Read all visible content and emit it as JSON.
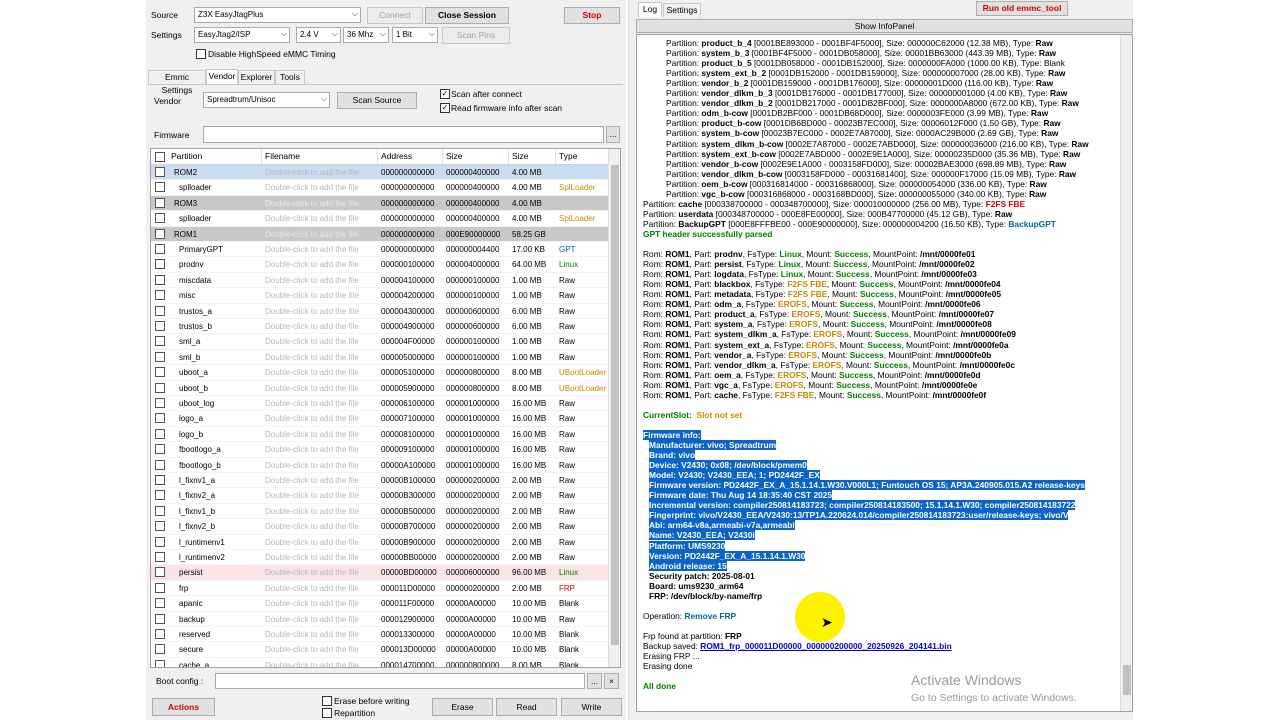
{
  "top": {
    "source_label": "Source",
    "source_value": "Z3X EasyJtagPlus",
    "connect_label": "Connect",
    "close_session_label": "Close Session",
    "stop_label": "Stop",
    "settings_label": "Settings",
    "settings_iface": "EasyJtag2/ISP",
    "settings_voltage": "2.4 V",
    "settings_freq": "36 Mhz",
    "settings_bits": "1 Bit",
    "scan_pins_label": "Scan Pins",
    "disable_hs_label": "Disable HighSpeed eMMC Timing"
  },
  "tabs": [
    "Emmc Settings",
    "Vendor",
    "Explorer",
    "Tools"
  ],
  "vendor": {
    "label": "Vendor",
    "value": "Spreadtrum/Unisoc",
    "scan_source_label": "Scan Source",
    "scan_after_connect": "Scan after connect",
    "read_fw_info": "Read firmware info after scan"
  },
  "firmware": {
    "label": "Firmware",
    "value": "",
    "browse": "..."
  },
  "grid": {
    "columns": [
      "Partition",
      "Filename",
      "Address",
      "Size",
      "Size",
      "Type"
    ],
    "rows": [
      {
        "p": "ROM2",
        "f": "Double-click to add the file",
        "a": "000000000000",
        "s": "000000400000",
        "h": "4.00 MB",
        "t": "",
        "kind": "sel"
      },
      {
        "p": "splloader",
        "f": "Double-click to add the file",
        "a": "000000000000",
        "s": "000000400000",
        "h": "4.00 MB",
        "t": "SplLoader",
        "kind": "sub"
      },
      {
        "p": "ROM3",
        "f": "Double-click to add the file",
        "a": "000000000000",
        "s": "000000400000",
        "h": "4.00 MB",
        "t": "",
        "kind": "grp"
      },
      {
        "p": "splloader",
        "f": "Double-click to add the file",
        "a": "000000000000",
        "s": "000000400000",
        "h": "4.00 MB",
        "t": "SplLoader",
        "kind": "sub"
      },
      {
        "p": "ROM1",
        "f": "Double-click to add the file",
        "a": "000000000000",
        "s": "000E90000000",
        "h": "58.25 GB",
        "t": "",
        "kind": "grp"
      },
      {
        "p": "PrimaryGPT",
        "f": "Double-click to add the file",
        "a": "000000000000",
        "s": "000000004400",
        "h": "17.00 KB",
        "t": "GPT",
        "kind": "sub"
      },
      {
        "p": "prodnv",
        "f": "Double-click to add the file",
        "a": "000000100000",
        "s": "000004000000",
        "h": "64.00 MB",
        "t": "Linux",
        "kind": "sub"
      },
      {
        "p": "miscdata",
        "f": "Double-click to add the file",
        "a": "000004100000",
        "s": "000000100000",
        "h": "1.00 MB",
        "t": "Raw",
        "kind": "sub"
      },
      {
        "p": "misc",
        "f": "Double-click to add the file",
        "a": "000004200000",
        "s": "000000100000",
        "h": "1.00 MB",
        "t": "Raw",
        "kind": "sub"
      },
      {
        "p": "trustos_a",
        "f": "Double-click to add the file",
        "a": "000004300000",
        "s": "000000600000",
        "h": "6.00 MB",
        "t": "Raw",
        "kind": "sub"
      },
      {
        "p": "trustos_b",
        "f": "Double-click to add the file",
        "a": "000004900000",
        "s": "000000600000",
        "h": "6.00 MB",
        "t": "Raw",
        "kind": "sub"
      },
      {
        "p": "sml_a",
        "f": "Double-click to add the file",
        "a": "000004F00000",
        "s": "000000100000",
        "h": "1.00 MB",
        "t": "Raw",
        "kind": "sub"
      },
      {
        "p": "sml_b",
        "f": "Double-click to add the file",
        "a": "000005000000",
        "s": "000000100000",
        "h": "1.00 MB",
        "t": "Raw",
        "kind": "sub"
      },
      {
        "p": "uboot_a",
        "f": "Double-click to add the file",
        "a": "000005100000",
        "s": "000000800000",
        "h": "8.00 MB",
        "t": "UBootLoader",
        "kind": "sub"
      },
      {
        "p": "uboot_b",
        "f": "Double-click to add the file",
        "a": "000005900000",
        "s": "000000800000",
        "h": "8.00 MB",
        "t": "UBootLoader",
        "kind": "sub"
      },
      {
        "p": "uboot_log",
        "f": "Double-click to add the file",
        "a": "000006100000",
        "s": "000001000000",
        "h": "16.00 MB",
        "t": "Raw",
        "kind": "sub"
      },
      {
        "p": "logo_a",
        "f": "Double-click to add the file",
        "a": "000007100000",
        "s": "000001000000",
        "h": "16.00 MB",
        "t": "Raw",
        "kind": "sub"
      },
      {
        "p": "logo_b",
        "f": "Double-click to add the file",
        "a": "000008100000",
        "s": "000001000000",
        "h": "16.00 MB",
        "t": "Raw",
        "kind": "sub"
      },
      {
        "p": "fbootlogo_a",
        "f": "Double-click to add the file",
        "a": "000009100000",
        "s": "000001000000",
        "h": "16.00 MB",
        "t": "Raw",
        "kind": "sub"
      },
      {
        "p": "fbootlogo_b",
        "f": "Double-click to add the file",
        "a": "00000A100000",
        "s": "000001000000",
        "h": "16.00 MB",
        "t": "Raw",
        "kind": "sub"
      },
      {
        "p": "l_fixnv1_a",
        "f": "Double-click to add the file",
        "a": "00000B100000",
        "s": "000000200000",
        "h": "2.00 MB",
        "t": "Raw",
        "kind": "sub"
      },
      {
        "p": "l_fixnv2_a",
        "f": "Double-click to add the file",
        "a": "00000B300000",
        "s": "000000200000",
        "h": "2.00 MB",
        "t": "Raw",
        "kind": "sub"
      },
      {
        "p": "l_fixnv1_b",
        "f": "Double-click to add the file",
        "a": "00000B500000",
        "s": "000000200000",
        "h": "2.00 MB",
        "t": "Raw",
        "kind": "sub"
      },
      {
        "p": "l_fixnv2_b",
        "f": "Double-click to add the file",
        "a": "00000B700000",
        "s": "000000200000",
        "h": "2.00 MB",
        "t": "Raw",
        "kind": "sub"
      },
      {
        "p": "l_runtimenv1",
        "f": "Double-click to add the file",
        "a": "00000B900000",
        "s": "000000200000",
        "h": "2.00 MB",
        "t": "Raw",
        "kind": "sub"
      },
      {
        "p": "l_runtimenv2",
        "f": "Double-click to add the file",
        "a": "00000BB00000",
        "s": "000000200000",
        "h": "2.00 MB",
        "t": "Raw",
        "kind": "sub"
      },
      {
        "p": "persist",
        "f": "Double-click to add the file",
        "a": "00000BD00000",
        "s": "000006000000",
        "h": "96.00 MB",
        "t": "Linux",
        "kind": "pink"
      },
      {
        "p": "frp",
        "f": "Double-click to add the file",
        "a": "000011D00000",
        "s": "000000200000",
        "h": "2.00 MB",
        "t": "FRP",
        "kind": "sub"
      },
      {
        "p": "apanic",
        "f": "Double-click to add the file",
        "a": "000011F00000",
        "s": "00000A00000",
        "h": "10.00 MB",
        "t": "Blank",
        "kind": "sub"
      },
      {
        "p": "backup",
        "f": "Double-click to add the file",
        "a": "000012900000",
        "s": "00000A00000",
        "h": "10.00 MB",
        "t": "Raw",
        "kind": "sub"
      },
      {
        "p": "reserved",
        "f": "Double-click to add the file",
        "a": "000013300000",
        "s": "00000A00000",
        "h": "10.00 MB",
        "t": "Blank",
        "kind": "sub"
      },
      {
        "p": "secure",
        "f": "Double-click to add the file",
        "a": "000013D00000",
        "s": "00000A00000",
        "h": "10.00 MB",
        "t": "Blank",
        "kind": "sub"
      },
      {
        "p": "cache_a",
        "f": "Double-click to add the file",
        "a": "000014700000",
        "s": "000000800000",
        "h": "8.00 MB",
        "t": "Blank",
        "kind": "sub"
      }
    ]
  },
  "bottom": {
    "boot_config_label": "Boot config :",
    "boot_config_value": "",
    "browse": "...",
    "clear": "×",
    "actions_label": "Actions",
    "erase_before_writing": "Erase before writing",
    "repartition": "Repartition",
    "erase_label": "Erase",
    "read_label": "Read",
    "write_label": "Write"
  },
  "right": {
    "tabs": [
      "Log",
      "Settings"
    ],
    "run_old_label": "Run old emmc_tool",
    "show_infopanel_label": "Show InfoPanel"
  },
  "type_colors": {
    "SplLoader": "#cc8800",
    "UBootLoader": "#cc8800",
    "GPT": "#006699",
    "Linux": "#008000",
    "FRP": "#e00000",
    "Raw": "#000000",
    "Blank": "#000000"
  },
  "log": {
    "partitions": [
      {
        "ind": "    ",
        "name": "product_b_4",
        "range": "[0001BE893000 - 0001BF4F5000]",
        "size": "000000C62000 (12.38 MB)",
        "type": "Raw"
      },
      {
        "ind": "    ",
        "name": "system_b_3",
        "range": "[0001BF4F5000 - 0001DB058000]",
        "size": "00001BB63000 (443.39 MB)",
        "type": "Raw"
      },
      {
        "ind": "    ",
        "name": "product_b_5",
        "range": "[0001DB058000 - 0001DB152000]",
        "size": "0000000FA000 (1000.00 KB)",
        "type": "Blank"
      },
      {
        "ind": "    ",
        "name": "system_ext_b_2",
        "range": "[0001DB152000 - 0001DB159000]",
        "size": "000000007000 (28.00 KB)",
        "type": "Raw"
      },
      {
        "ind": "    ",
        "name": "vendor_b_2",
        "range": "[0001DB159000 - 0001DB176000]",
        "size": "00000001D000 (116.00 KB)",
        "type": "Raw"
      },
      {
        "ind": "    ",
        "name": "vendor_dlkm_b_3",
        "range": "[0001DB176000 - 0001DB177000]",
        "size": "000000001000 (4.00 KB)",
        "type": "Raw"
      },
      {
        "ind": "    ",
        "name": "vendor_dlkm_b_2",
        "range": "[0001DB217000 - 0001DB2BF000]",
        "size": "0000000A8000 (672.00 KB)",
        "type": "Raw"
      },
      {
        "ind": "    ",
        "name": "odm_b-cow",
        "range": "[0001DB2BF000 - 0001DB68D000]",
        "size": "0000003FE000 (3.99 MB)",
        "type": "Raw"
      },
      {
        "ind": "    ",
        "name": "product_b-cow",
        "range": "[0001DB6BD000 - 00023B7EC000]",
        "size": "00006012F000 (1.50 GB)",
        "type": "Raw"
      },
      {
        "ind": "    ",
        "name": "system_b-cow",
        "range": "[00023B7EC000 - 0002E7A87000]",
        "size": "0000AC29B000 (2.69 GB)",
        "type": "Raw"
      },
      {
        "ind": "    ",
        "name": "system_dlkm_b-cow",
        "range": "[0002E7A87000 - 0002E7ABD000]",
        "size": "000000036000 (216.00 KB)",
        "type": "Raw"
      },
      {
        "ind": "    ",
        "name": "system_ext_b-cow",
        "range": "[0002E7ABD000 - 0002E9E1A000]",
        "size": "00000235D000 (35.36 MB)",
        "type": "Raw"
      },
      {
        "ind": "    ",
        "name": "vendor_b-cow",
        "range": "[0002E9E1A000 - 0003158FD000]",
        "size": "00002BAE3000 (698.89 MB)",
        "type": "Raw"
      },
      {
        "ind": "    ",
        "name": "vendor_dlkm_b-cow",
        "range": "[0003158FD000 - 00031681400]",
        "size": "000000F17000 (15.09 MB)",
        "type": "Raw"
      },
      {
        "ind": "    ",
        "name": "oem_b-cow",
        "range": "[000316814000 - 000316868000]",
        "size": "000000054000 (336.00 KB)",
        "type": "Raw"
      },
      {
        "ind": "    ",
        "name": "vgc_b-cow",
        "range": "[000316868000 - 0003168BD000]",
        "size": "000000055000 (340.00 KB)",
        "type": "Raw"
      },
      {
        "ind": "",
        "name": "cache",
        "range": "[000338700000 - 000348700000]",
        "size": "000010000000 (256.00 MB)",
        "type": "F2FS FBE"
      },
      {
        "ind": "",
        "name": "userdata",
        "range": "[000348700000 - 000E8FE00000]",
        "size": "000B47700000 (45.12 GB)",
        "type": "Raw"
      },
      {
        "ind": "",
        "name": "BackupGPT",
        "range": "[000E8FFFBE00 - 000E90000000]",
        "size": "000000004200 (16.50 KB)",
        "type": "BackupGPT"
      }
    ],
    "gpt_parsed": "GPT header successfully parsed",
    "mounts": [
      {
        "part": "prodnv",
        "fs": "Linux",
        "mp": "/mnt/0000fe01"
      },
      {
        "part": "persist",
        "fs": "Linux",
        "mp": "/mnt/0000fe02"
      },
      {
        "part": "logdata",
        "fs": "Linux",
        "mp": "/mnt/0000fe03"
      },
      {
        "part": "blackbox",
        "fs": "F2FS FBE",
        "mp": "/mnt/0000fe04"
      },
      {
        "part": "metadata",
        "fs": "F2FS FBE",
        "mp": "/mnt/0000fe05"
      },
      {
        "part": "odm_a",
        "fs": "EROFS",
        "mp": "/mnt/0000fe06"
      },
      {
        "part": "product_a",
        "fs": "EROFS",
        "mp": "/mnt/0000fe07"
      },
      {
        "part": "system_a",
        "fs": "EROFS",
        "mp": "/mnt/0000fe08"
      },
      {
        "part": "system_dlkm_a",
        "fs": "EROFS",
        "mp": "/mnt/0000fe09"
      },
      {
        "part": "system_ext_a",
        "fs": "EROFS",
        "mp": "/mnt/0000fe0a"
      },
      {
        "part": "vendor_a",
        "fs": "EROFS",
        "mp": "/mnt/0000fe0b"
      },
      {
        "part": "vendor_dlkm_a",
        "fs": "EROFS",
        "mp": "/mnt/0000fe0c"
      },
      {
        "part": "oem_a",
        "fs": "EROFS",
        "mp": "/mnt/0000fe0d"
      },
      {
        "part": "vgc_a",
        "fs": "EROFS",
        "mp": "/mnt/0000fe0e"
      },
      {
        "part": "cache",
        "fs": "F2FS FBE",
        "mp": "/mnt/0000fe0f"
      }
    ],
    "current_slot_label": "CurrentSlot:",
    "current_slot_value": "Slot not set",
    "fw_header": "Firmware info:",
    "fw_lines_selected": [
      "Manufacturer: vivo;  Spreadtrum",
      "Brand: vivo",
      "Device: V2430;  0x08;  /dev/block/pmem0",
      "Model: V2430;  V2430_EEA;  1;  PD2442F_EX",
      "Firmware version: PD2442F_EX_A_15.1.14.1.W30.V000L1;  Funtouch OS 15;  AP3A.240905.015.A2 release-keys",
      "Firmware date: Thu Aug 14 18:35:40 CST 2025",
      "Incremental version: compiler250814183723;  compiler250814183500;  15.1.14.1.W30;  compiler250814183722",
      "Fingerprint: vivo/V2430_EEA/V2430:13/TP1A.220624.014/compiler250814183723:user/release-keys;  vivo/V",
      "Abi: arm64-v8a,armeabi-v7a,armeabi",
      "Name: V2430_EEA;  V2430i",
      "Platform: UMS9230",
      "Version: PD2442F_EX_A_15.1.14.1.W30",
      "Android release: 15"
    ],
    "fw_lines_normal": [
      "Security patch: 2025-08-01",
      "Board: ums9230_arm64",
      "FRP: /dev/block/by-name/frp"
    ],
    "operation_label": "Operation:",
    "operation_value": "Remove FRP",
    "frp_found_label": "Frp found at partition:",
    "frp_found_value": "FRP",
    "backup_saved_label": "Backup saved:",
    "backup_saved_value": "ROM1_frp_000011D00000_000000200000_20250926_204141.bin",
    "erasing": "Erasing FRP ...",
    "erasing_done": "Erasing done",
    "all_done": "All done"
  },
  "watermark": {
    "line1": "Activate Windows",
    "line2": "Go to Settings to activate Windows."
  }
}
